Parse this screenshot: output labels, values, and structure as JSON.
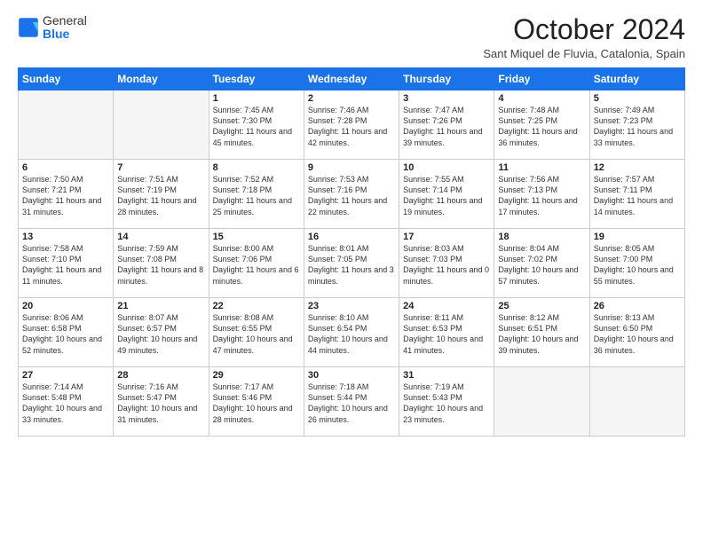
{
  "header": {
    "logo_general": "General",
    "logo_blue": "Blue",
    "month_title": "October 2024",
    "subtitle": "Sant Miquel de Fluvia, Catalonia, Spain"
  },
  "days_of_week": [
    "Sunday",
    "Monday",
    "Tuesday",
    "Wednesday",
    "Thursday",
    "Friday",
    "Saturday"
  ],
  "weeks": [
    [
      {
        "day": "",
        "empty": true
      },
      {
        "day": "",
        "empty": true
      },
      {
        "day": "1",
        "sunrise": "7:45 AM",
        "sunset": "7:30 PM",
        "daylight": "11 hours and 45 minutes."
      },
      {
        "day": "2",
        "sunrise": "7:46 AM",
        "sunset": "7:28 PM",
        "daylight": "11 hours and 42 minutes."
      },
      {
        "day": "3",
        "sunrise": "7:47 AM",
        "sunset": "7:26 PM",
        "daylight": "11 hours and 39 minutes."
      },
      {
        "day": "4",
        "sunrise": "7:48 AM",
        "sunset": "7:25 PM",
        "daylight": "11 hours and 36 minutes."
      },
      {
        "day": "5",
        "sunrise": "7:49 AM",
        "sunset": "7:23 PM",
        "daylight": "11 hours and 33 minutes."
      }
    ],
    [
      {
        "day": "6",
        "sunrise": "7:50 AM",
        "sunset": "7:21 PM",
        "daylight": "11 hours and 31 minutes."
      },
      {
        "day": "7",
        "sunrise": "7:51 AM",
        "sunset": "7:19 PM",
        "daylight": "11 hours and 28 minutes."
      },
      {
        "day": "8",
        "sunrise": "7:52 AM",
        "sunset": "7:18 PM",
        "daylight": "11 hours and 25 minutes."
      },
      {
        "day": "9",
        "sunrise": "7:53 AM",
        "sunset": "7:16 PM",
        "daylight": "11 hours and 22 minutes."
      },
      {
        "day": "10",
        "sunrise": "7:55 AM",
        "sunset": "7:14 PM",
        "daylight": "11 hours and 19 minutes."
      },
      {
        "day": "11",
        "sunrise": "7:56 AM",
        "sunset": "7:13 PM",
        "daylight": "11 hours and 17 minutes."
      },
      {
        "day": "12",
        "sunrise": "7:57 AM",
        "sunset": "7:11 PM",
        "daylight": "11 hours and 14 minutes."
      }
    ],
    [
      {
        "day": "13",
        "sunrise": "7:58 AM",
        "sunset": "7:10 PM",
        "daylight": "11 hours and 11 minutes."
      },
      {
        "day": "14",
        "sunrise": "7:59 AM",
        "sunset": "7:08 PM",
        "daylight": "11 hours and 8 minutes."
      },
      {
        "day": "15",
        "sunrise": "8:00 AM",
        "sunset": "7:06 PM",
        "daylight": "11 hours and 6 minutes."
      },
      {
        "day": "16",
        "sunrise": "8:01 AM",
        "sunset": "7:05 PM",
        "daylight": "11 hours and 3 minutes."
      },
      {
        "day": "17",
        "sunrise": "8:03 AM",
        "sunset": "7:03 PM",
        "daylight": "11 hours and 0 minutes."
      },
      {
        "day": "18",
        "sunrise": "8:04 AM",
        "sunset": "7:02 PM",
        "daylight": "10 hours and 57 minutes."
      },
      {
        "day": "19",
        "sunrise": "8:05 AM",
        "sunset": "7:00 PM",
        "daylight": "10 hours and 55 minutes."
      }
    ],
    [
      {
        "day": "20",
        "sunrise": "8:06 AM",
        "sunset": "6:58 PM",
        "daylight": "10 hours and 52 minutes."
      },
      {
        "day": "21",
        "sunrise": "8:07 AM",
        "sunset": "6:57 PM",
        "daylight": "10 hours and 49 minutes."
      },
      {
        "day": "22",
        "sunrise": "8:08 AM",
        "sunset": "6:55 PM",
        "daylight": "10 hours and 47 minutes."
      },
      {
        "day": "23",
        "sunrise": "8:10 AM",
        "sunset": "6:54 PM",
        "daylight": "10 hours and 44 minutes."
      },
      {
        "day": "24",
        "sunrise": "8:11 AM",
        "sunset": "6:53 PM",
        "daylight": "10 hours and 41 minutes."
      },
      {
        "day": "25",
        "sunrise": "8:12 AM",
        "sunset": "6:51 PM",
        "daylight": "10 hours and 39 minutes."
      },
      {
        "day": "26",
        "sunrise": "8:13 AM",
        "sunset": "6:50 PM",
        "daylight": "10 hours and 36 minutes."
      }
    ],
    [
      {
        "day": "27",
        "sunrise": "7:14 AM",
        "sunset": "5:48 PM",
        "daylight": "10 hours and 33 minutes."
      },
      {
        "day": "28",
        "sunrise": "7:16 AM",
        "sunset": "5:47 PM",
        "daylight": "10 hours and 31 minutes."
      },
      {
        "day": "29",
        "sunrise": "7:17 AM",
        "sunset": "5:46 PM",
        "daylight": "10 hours and 28 minutes."
      },
      {
        "day": "30",
        "sunrise": "7:18 AM",
        "sunset": "5:44 PM",
        "daylight": "10 hours and 26 minutes."
      },
      {
        "day": "31",
        "sunrise": "7:19 AM",
        "sunset": "5:43 PM",
        "daylight": "10 hours and 23 minutes."
      },
      {
        "day": "",
        "empty": true
      },
      {
        "day": "",
        "empty": true
      }
    ]
  ]
}
